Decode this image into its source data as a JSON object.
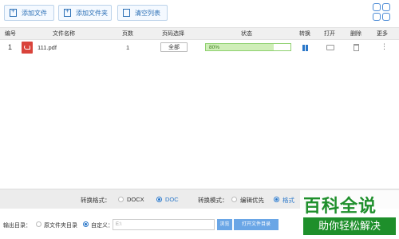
{
  "toolbar": {
    "add_file": "添加文件",
    "add_folder": "添加文件夹",
    "clear_list": "清空列表"
  },
  "table": {
    "headers": [
      "编号",
      "文件名称",
      "页数",
      "页码选择",
      "状态",
      "转换",
      "打开",
      "删除",
      "更多"
    ],
    "rows": [
      {
        "index": "1",
        "filename": "111.pdf",
        "pages": "1",
        "range": "全部",
        "progress_text": "80%",
        "progress": 0.8
      }
    ]
  },
  "format": {
    "label": "转换格式：",
    "options": [
      "DOCX",
      "DOC"
    ],
    "selected": "DOC",
    "mode_label": "转换模式：",
    "mode_options": [
      "编辑优先",
      "格式"
    ],
    "mode_selected": "格式"
  },
  "output": {
    "label": "输出目录：",
    "option_source": "原文件夹目录",
    "option_custom": "自定义：",
    "path_value": "E:\\",
    "browse": "浏览",
    "open_folder": "打开文件目录"
  },
  "watermark": {
    "top": "百科全说",
    "bottom": "助你轻松解决"
  },
  "colors": {
    "accent": "#2a77c9",
    "progress_fill": "#cfeeb8",
    "pdf_red": "#d9433b",
    "watermark_green": "#1e8f2b"
  },
  "icons": [
    "add-file-icon",
    "add-folder-icon",
    "trash-icon",
    "grid-view-icon",
    "pdf-file-icon",
    "pause-icon",
    "folder-open-icon",
    "delete-icon",
    "more-icon"
  ]
}
